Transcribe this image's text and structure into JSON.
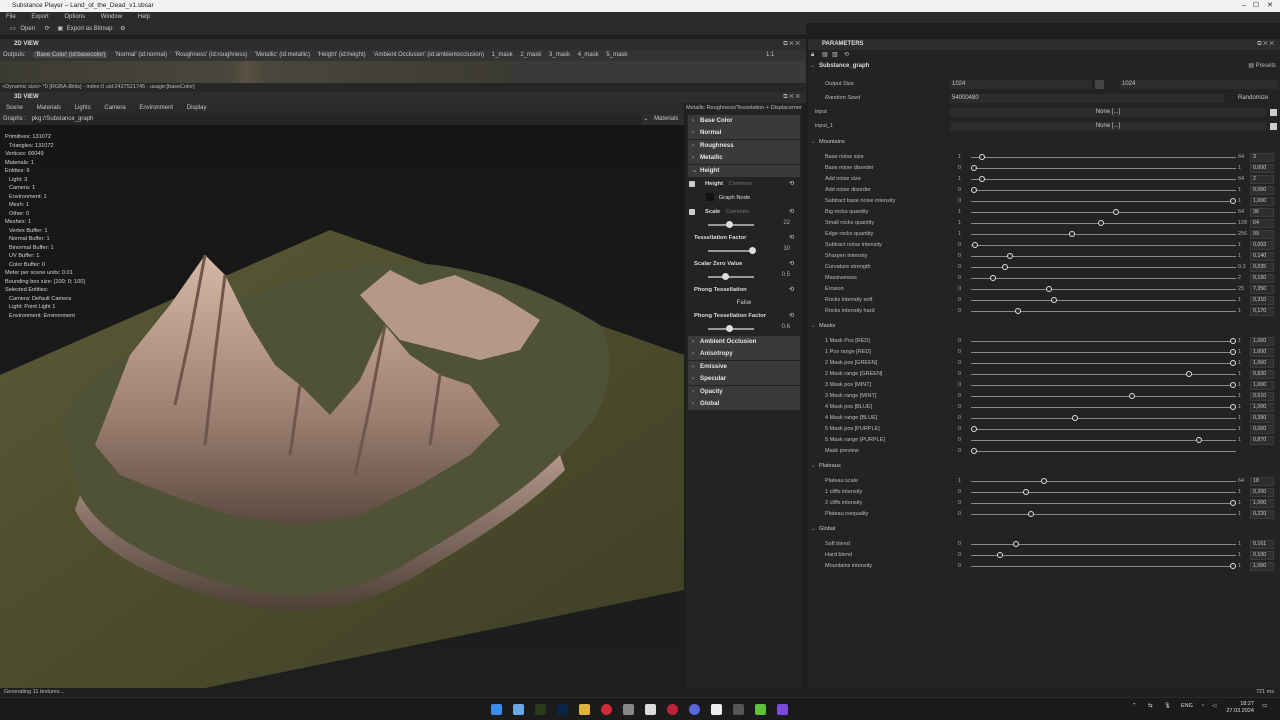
{
  "window": {
    "title": "Substance Player – Land_of_the_Dead_v1.sbsar"
  },
  "menu": [
    "File",
    "Export",
    "Options",
    "Window",
    "Help"
  ],
  "toolbar": {
    "open": "Open",
    "export_bitmap": "Export as Bitmap"
  },
  "view2d": {
    "title": "2D VIEW",
    "outputs_label": "Outputs:",
    "outputs": [
      "'Base Color' (id:basecolor)",
      "'Normal' (id:normal)",
      "'Roughness' (id:roughness)",
      "'Metallic' (id:metallic)",
      "'Height' (id:height)",
      "'Ambient Occlusion' (id:ambientocclusion)",
      "1_mask",
      "2_mask",
      "3_mask",
      "4_mask",
      "5_mask"
    ],
    "zoom": "1:1",
    "info": "<Dynamic size> *0 [RGBA-8bits] - index:0 uid:2427521745 - usage:[baseColor]"
  },
  "view3d": {
    "title": "3D VIEW",
    "menu": [
      "Scene",
      "Materials",
      "Lights",
      "Camera",
      "Environment",
      "Display"
    ],
    "graphs_label": "Graphs :",
    "graph_path": "pkg://Substance_graph",
    "materials_label": "Materials",
    "stats": [
      "Primitives: 131072",
      "  Triangles: 131072",
      "Vertices: 66049",
      "Materials: 1",
      "Entities: 6",
      "  Light: 3",
      "  Camera: 1",
      "  Environment: 1",
      "  Mesh: 1",
      "  Other: 0",
      "Meshes: 1",
      "  Vertex Buffer: 1",
      "  Normal Buffer: 1",
      "  Binormal Buffer: 1",
      "  UV Buffer: 1",
      "  Color Buffer: 0",
      "Meter per scene units: 0.01",
      "Bounding box size: [100; 0; 100]",
      "Selected Entities:",
      "  Camera: Default Camera",
      "  Light: Point Light 1",
      "  Environment: Environment"
    ]
  },
  "material": {
    "header": "Metallic Roughness/Tesselation + Displacement",
    "channels_top": [
      "Base Color",
      "Normal",
      "Roughness",
      "Metallic",
      "Height"
    ],
    "height_label": "Height",
    "height_tag": "Common",
    "graph_node": "Graph Node",
    "scale_label": "Scale",
    "scale_tag": "Common",
    "scale_value": "22",
    "tess_label": "Tessellation Factor",
    "tess_value": "30",
    "scalar_label": "Scalar Zero Value",
    "scalar_value": "0.5",
    "phong_label": "Phong Tessellation",
    "phong_value": "False",
    "phong_factor_label": "Phong Tessellation Factor",
    "phong_factor_value": "0.6",
    "channels_bottom": [
      "Ambient Occlusion",
      "Anisotropy",
      "Emissive",
      "Specular",
      "Opacity",
      "Global"
    ]
  },
  "params": {
    "title": "PARAMETERS",
    "graph": "Substance_graph",
    "presets": "Presets",
    "output_size_label": "Output Size",
    "output_size_a": "1024",
    "output_size_b": "1024",
    "random_seed_label": "Random Seed",
    "random_seed": "54000480",
    "randomize": "Randomize",
    "input_label": "input",
    "input_value": "None [...]",
    "input1_label": "input_1",
    "input1_value": "None [...]",
    "groups": [
      {
        "name": "Mountains",
        "rows": [
          {
            "label": "Base noise size",
            "min": "1",
            "max": "64",
            "value": "3",
            "level": 0.03
          },
          {
            "label": "Base noise disorder",
            "min": "0",
            "max": "1",
            "value": "0,000",
            "level": 0.0
          },
          {
            "label": "Add noise size",
            "min": "1",
            "max": "64",
            "value": "2",
            "level": 0.03
          },
          {
            "label": "Add noise disorder",
            "min": "0",
            "max": "1",
            "value": "0,000",
            "level": 0.0
          },
          {
            "label": "Subtract base noise intensity",
            "min": "0",
            "max": "1",
            "value": "1,000",
            "level": 1.0
          },
          {
            "label": "Big rocks quantity",
            "min": "1",
            "max": "64",
            "value": "36",
            "level": 0.55
          },
          {
            "label": "Small rocks quantity",
            "min": "1",
            "max": "128",
            "value": "64",
            "level": 0.49
          },
          {
            "label": "Edge rocks quantity",
            "min": "1",
            "max": "256",
            "value": "99",
            "level": 0.38
          },
          {
            "label": "Subtract noise intensity",
            "min": "0",
            "max": "1",
            "value": "0,003",
            "level": 0.003
          },
          {
            "label": "Sharpen intensity",
            "min": "0",
            "max": "1",
            "value": "0,140",
            "level": 0.14
          },
          {
            "label": "Curvature strength",
            "min": "0",
            "max": "0.3",
            "value": "0,035",
            "level": 0.12
          },
          {
            "label": "Massiveness",
            "min": "0",
            "max": "2",
            "value": "0,150",
            "level": 0.075
          },
          {
            "label": "Erosion",
            "min": "0",
            "max": "25",
            "value": "7,350",
            "level": 0.29
          },
          {
            "label": "Rocks intensity soft",
            "min": "0",
            "max": "1",
            "value": "0,310",
            "level": 0.31
          },
          {
            "label": "Rocks intensity hard",
            "min": "0",
            "max": "1",
            "value": "0,170",
            "level": 0.17
          }
        ]
      },
      {
        "name": "Masks",
        "rows": [
          {
            "label": "1 Mask Pos [RED]",
            "min": "0",
            "max": "1",
            "value": "1,000",
            "level": 1.0
          },
          {
            "label": "1 Pos range [RED]",
            "min": "0",
            "max": "1",
            "value": "1,000",
            "level": 1.0
          },
          {
            "label": "2 Mask pos [GREEN]",
            "min": "0",
            "max": "1",
            "value": "1,000",
            "level": 1.0
          },
          {
            "label": "2 Mask range [GREEN]",
            "min": "0",
            "max": "1",
            "value": "0,830",
            "level": 0.83
          },
          {
            "label": "3 Mask pos [MINT]",
            "min": "0",
            "max": "1",
            "value": "1,000",
            "level": 1.0
          },
          {
            "label": "3 Mask range [MINT]",
            "min": "0",
            "max": "1",
            "value": "0,610",
            "level": 0.61
          },
          {
            "label": "4 Mask pos [BLUE]",
            "min": "0",
            "max": "1",
            "value": "1,000",
            "level": 1.0
          },
          {
            "label": "4 Mask range [BLUE]",
            "min": "0",
            "max": "1",
            "value": "0,390",
            "level": 0.39
          },
          {
            "label": "5 Mask pos [PURPLE]",
            "min": "0",
            "max": "1",
            "value": "0,000",
            "level": 0.0
          },
          {
            "label": "5 Mask range [PURPLE]",
            "min": "0",
            "max": "1",
            "value": "0,870",
            "level": 0.87
          },
          {
            "label": "Mask preview",
            "min": "0",
            "max": "",
            "value": "",
            "level": 0.0
          }
        ]
      },
      {
        "name": "Plateaus",
        "rows": [
          {
            "label": "Plateau scale",
            "min": "1",
            "max": "64",
            "value": "18",
            "level": 0.27
          },
          {
            "label": "1 cliffs intensity",
            "min": "0",
            "max": "1",
            "value": "0,200",
            "level": 0.2
          },
          {
            "label": "2 cliffs intensity",
            "min": "0",
            "max": "1",
            "value": "1,000",
            "level": 1.0
          },
          {
            "label": "Plateau inequality",
            "min": "0",
            "max": "1",
            "value": "0,220",
            "level": 0.22
          }
        ]
      },
      {
        "name": "Global",
        "rows": [
          {
            "label": "Soft blend",
            "min": "0",
            "max": "1",
            "value": "0,161",
            "level": 0.161
          },
          {
            "label": "Hard blend",
            "min": "0",
            "max": "1",
            "value": "0,100",
            "level": 0.1
          },
          {
            "label": "Mountains intensity",
            "min": "0",
            "max": "1",
            "value": "1,000",
            "level": 1.0
          }
        ]
      }
    ]
  },
  "status": {
    "left": "Generating 11 textures...",
    "right": "721 ms"
  },
  "taskbar": {
    "lang": "ENG",
    "time": "18:27",
    "date": "27.03.2024"
  },
  "colors": {
    "ground": "#4a4a2c",
    "rock": "#b89a88",
    "panel": "#232323"
  }
}
